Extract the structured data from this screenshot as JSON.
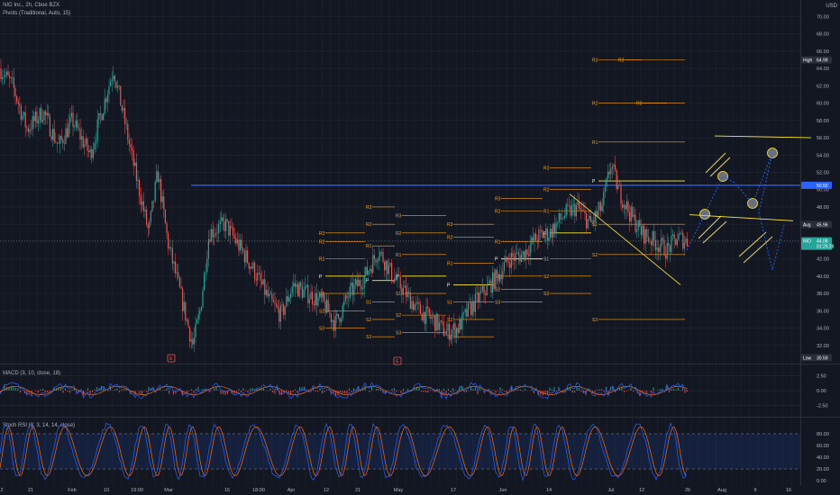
{
  "header": {
    "title": "NIO Inc., 2h, Cboe BZX",
    "indicator": "Pivots (Traditional, Auto, 15)",
    "currency": "USD"
  },
  "colors": {
    "background": "#131722",
    "grid": "#2a2e39",
    "candle_up": "#26a69a",
    "candle_down": "#ef5350",
    "pivot_line": "#f7a21b",
    "pivot_p": "#ffffff",
    "resistance_line": "#2962ff",
    "trend_line": "#ffeb3b",
    "macd_line": "#2962ff",
    "signal_line": "#ff6d00",
    "stoch_k": "#2962ff",
    "stoch_d": "#ff6d00",
    "stoch_band": "#2962ff"
  },
  "price_axis": {
    "ticks": [
      "70.00",
      "68.00",
      "66.00",
      "64.00",
      "62.00",
      "60.00",
      "58.00",
      "56.00",
      "54.00",
      "52.00",
      "50.00",
      "48.00",
      "46.00",
      "44.00",
      "42.00",
      "40.00",
      "38.00",
      "36.00",
      "34.00",
      "32.00"
    ],
    "tick_values": [
      70,
      68,
      66,
      64,
      62,
      60,
      58,
      56,
      54,
      52,
      50,
      48,
      46,
      44,
      42,
      40,
      38,
      36,
      34,
      32
    ],
    "range": [
      30.0,
      71.5
    ]
  },
  "price_tags": [
    {
      "label": "High",
      "value_text": "64.99",
      "value": 64.99,
      "color": "#2a2e39"
    },
    {
      "label": "",
      "value_text": "50.50",
      "value": 50.5,
      "color": "#2962ff"
    },
    {
      "label": "Avg",
      "value_text": "45.96",
      "value": 45.96,
      "color": "#2a2e39"
    },
    {
      "label": "NIO",
      "value_text": "44.08",
      "value": 44.08,
      "color": "#26a69a"
    },
    {
      "label": "",
      "value_text": "01:25:28",
      "value": 43.45,
      "color": "#26a69a"
    },
    {
      "label": "Low",
      "value_text": "30.59",
      "value": 30.59,
      "color": "#2a2e39"
    }
  ],
  "time_axis": {
    "labels": [
      "2",
      "21",
      "Feb",
      "10",
      "19:00",
      "Mar",
      "15",
      "18:00",
      "Apr",
      "12",
      "21",
      "May",
      "17",
      "Jun",
      "14",
      "Jul",
      "12",
      "26",
      "Aug",
      "9",
      "16"
    ]
  },
  "macd": {
    "title": "MACD (3, 10, close, 18)",
    "ticks": [
      "2.50",
      "0.00",
      "-2.50"
    ],
    "tick_values": [
      2.5,
      0,
      -2.5
    ],
    "range": [
      -4.2,
      4.2
    ]
  },
  "stoch": {
    "title": "Stoch RSI (3, 3, 14, 14, close)",
    "ticks": [
      "80.00",
      "60.00",
      "40.00",
      "20.00",
      "0.00"
    ],
    "tick_values": [
      80,
      60,
      40,
      20,
      0
    ],
    "range": [
      -6,
      106
    ],
    "upper_band": 80,
    "lower_band": 20
  },
  "pivot_label_names": [
    "R3",
    "R2",
    "R1",
    "P",
    "S1",
    "S2",
    "S3"
  ],
  "event_marker_label": "E",
  "chart_data": {
    "type": "candlestick",
    "symbol": "NIO",
    "interval": "2h",
    "ylim": [
      30.0,
      71.5
    ],
    "horizontal_levels": [
      50.5
    ],
    "pivot_periods": [
      {
        "R3": 45.0,
        "R2": 44.0,
        "R1": 42.0,
        "P": 40.0,
        "S1": 38.0,
        "S2": 36.0,
        "S3": 34.0
      },
      {
        "R3": 48.0,
        "R2": 46.0,
        "R1": 43.5,
        "P": 39.5,
        "S1": 37.0,
        "S2": 35.0,
        "S3": 33.0
      },
      {
        "R3": 47.0,
        "R2": 45.0,
        "R1": 42.5,
        "P": 40.0,
        "S1": 38.0,
        "S2": 35.5,
        "S3": 33.5
      },
      {
        "R3": 46.0,
        "R2": 44.5,
        "R1": 41.5,
        "P": 39.0,
        "S1": 37.0,
        "S2": 35.0,
        "S3": 33.0
      },
      {
        "R3": 49.0,
        "R2": 47.5,
        "R1": 44.0,
        "P": 42.0,
        "S1": 40.0,
        "S2": 38.5,
        "S3": 37.0
      },
      {
        "R3": 52.5,
        "R2": 50.0,
        "R1": 47.5,
        "P": 45.0,
        "S1": 42.0,
        "S2": 40.0,
        "S3": 38.0
      },
      {
        "R3": 65.0,
        "R2": 60.0,
        "R1": 55.5,
        "P": 51.0,
        "S1": 46.0,
        "S2": 42.5,
        "S3": 35.0
      }
    ]
  }
}
